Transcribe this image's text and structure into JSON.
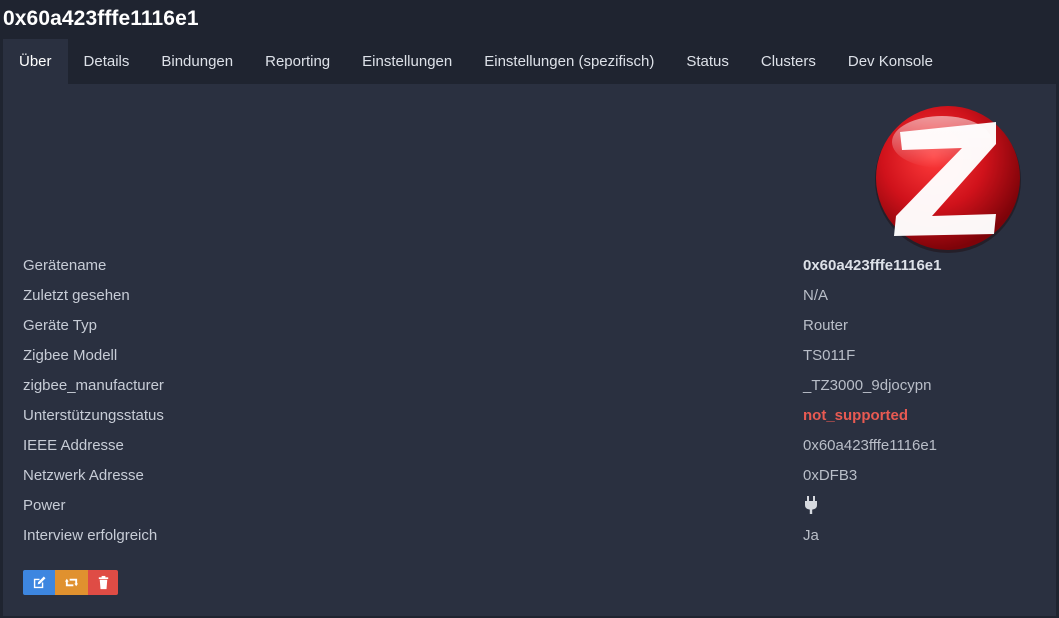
{
  "title": "0x60a423fffe1116e1",
  "tabs": [
    {
      "label": "Über",
      "active": true
    },
    {
      "label": "Details"
    },
    {
      "label": "Bindungen"
    },
    {
      "label": "Reporting"
    },
    {
      "label": "Einstellungen"
    },
    {
      "label": "Einstellungen (spezifisch)"
    },
    {
      "label": "Status"
    },
    {
      "label": "Clusters"
    },
    {
      "label": "Dev Konsole"
    }
  ],
  "logo": {
    "icon": "zigbee-logo",
    "color": "#d0121b"
  },
  "rows": [
    {
      "label": "Gerätename",
      "value": "0x60a423fffe1116e1"
    },
    {
      "label": "Zuletzt gesehen",
      "value": "N/A"
    },
    {
      "label": "Geräte Typ",
      "value": "Router"
    },
    {
      "label": "Zigbee Modell",
      "value": "TS011F"
    },
    {
      "label": "zigbee_manufacturer",
      "value": "_TZ3000_9djocypn"
    },
    {
      "label": "Unterstützungsstatus",
      "value": "not_supported"
    },
    {
      "label": "IEEE Addresse",
      "value": "0x60a423fffe1116e1"
    },
    {
      "label": "Netzwerk Adresse",
      "value": "0xDFB3"
    },
    {
      "label": "Power",
      "value_icon": "plug-icon"
    },
    {
      "label": "Interview erfolgreich",
      "value": "Ja"
    }
  ],
  "buttons": [
    {
      "icon": "edit-icon",
      "color": "#3d86e0"
    },
    {
      "icon": "retweet-icon",
      "color": "#e0912f"
    },
    {
      "icon": "trash-icon",
      "color": "#df4c45"
    }
  ],
  "colors": {
    "background": "#1f2430",
    "panel": "#2a3040",
    "not_supported": "#e85a52"
  }
}
